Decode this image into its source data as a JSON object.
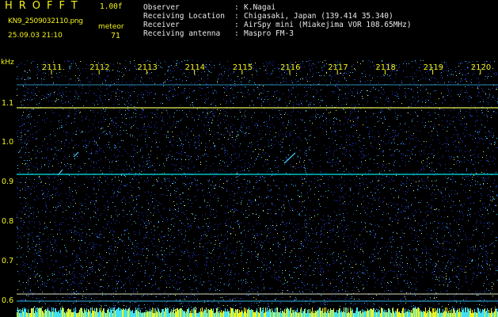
{
  "header": {
    "app_title": "HROFFT",
    "version": "1.00f",
    "filename": "KN9_2509032110.png",
    "meteor_label": "meteor",
    "datetime": "25.09.03 21:10",
    "meteor_count": "71",
    "info": [
      {
        "label": "Observer",
        "value": "K.Nagai"
      },
      {
        "label": "Receiving Location",
        "value": "Chigasaki, Japan (139.414 35.340)"
      },
      {
        "label": "Receiver",
        "value": "AirSpy mini (Miakejima VOR 108.65MHz)"
      },
      {
        "label": "Receiving antenna",
        "value": "Maspro FM-3"
      }
    ],
    "separator": ":"
  },
  "axes": {
    "y_unit": "kHz",
    "y_ticks": [
      "1.1",
      "1.0",
      "0.9",
      "0.8",
      "0.7",
      "0.6"
    ],
    "x_ticks": [
      "2111",
      "2112",
      "2113",
      "2114",
      "2115",
      "2116",
      "2117",
      "2118",
      "2119",
      "2120"
    ]
  },
  "colors": {
    "background": "#000000",
    "label": "#f2f21a",
    "text": "#e8e8e8",
    "noise": "#1a2aa0",
    "echo": "#e8f25a",
    "baseline": "#00e8e8"
  }
}
